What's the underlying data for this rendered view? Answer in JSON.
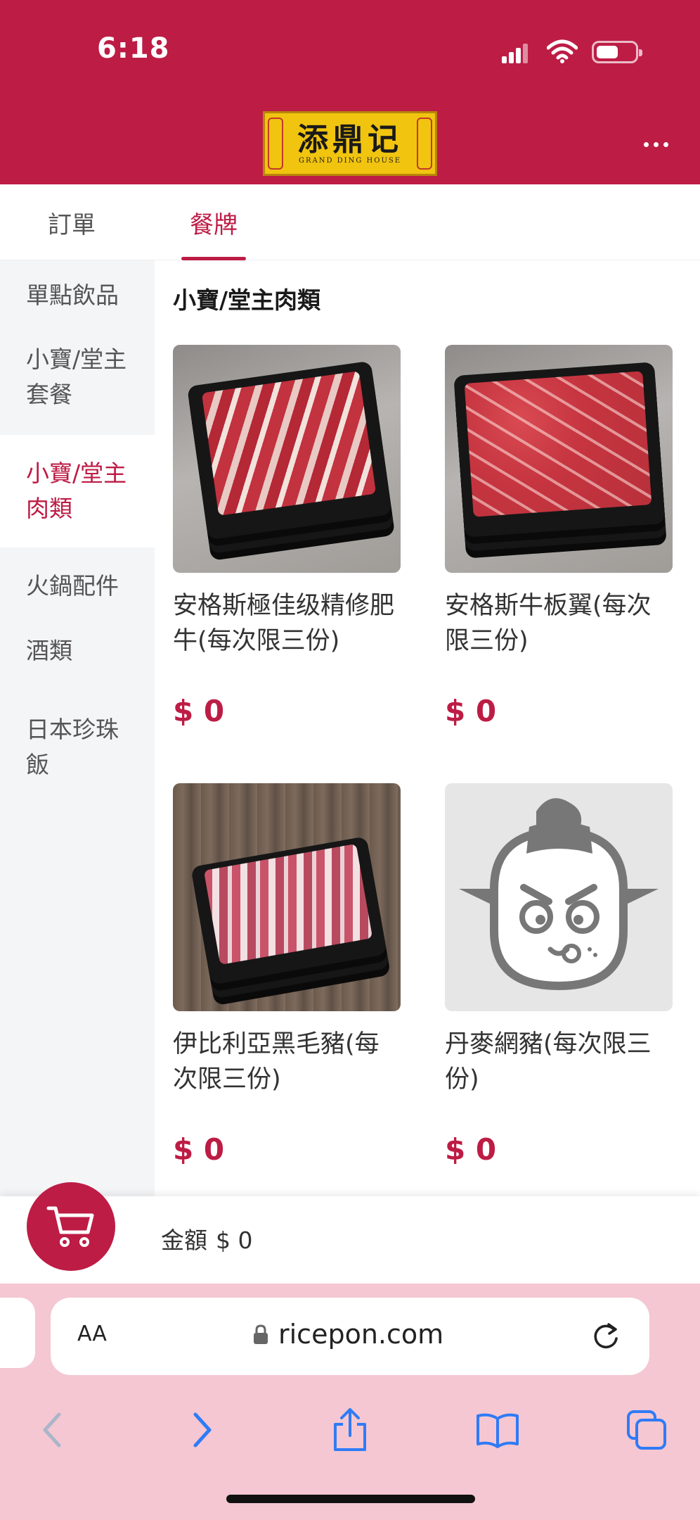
{
  "status_bar": {
    "time": "6:18"
  },
  "header": {
    "logo": {
      "text": "添鼎记",
      "subtitle": "GRAND DING HOUSE"
    },
    "more_icon": "more-horizontal-icon",
    "brand_color": "#bd1c45"
  },
  "tabs": [
    {
      "label": "訂單",
      "active": false
    },
    {
      "label": "餐牌",
      "active": true
    }
  ],
  "sidebar": {
    "items": [
      {
        "label": "單點飲品",
        "active": false
      },
      {
        "label": "小寶/堂主套餐",
        "active": false
      },
      {
        "label": "小寶/堂主肉類",
        "active": true
      },
      {
        "label": "火鍋配件",
        "active": false
      },
      {
        "label": "酒類",
        "active": false
      },
      {
        "label": "日本珍珠飯",
        "active": false
      }
    ]
  },
  "content": {
    "category_title": "小寶/堂主肉類",
    "products": [
      {
        "name": "安格斯極佳级精修肥牛(每次限三份)",
        "price": "$ 0",
        "image": "beef-photo"
      },
      {
        "name": "安格斯牛板翼(每次限三份)",
        "price": "$ 0",
        "image": "beef-photo"
      },
      {
        "name": "伊比利亞黑毛豬(每次限三份)",
        "price": "$ 0",
        "image": "pork-photo"
      },
      {
        "name": "丹麥網豬(每次限三份)",
        "price": "$ 0",
        "image": "placeholder-mascot"
      }
    ]
  },
  "cart": {
    "total_label": "金額",
    "total_value": "$ 0",
    "icon": "cart-icon"
  },
  "browser": {
    "text_size_label": "AA",
    "url": "ricepon.com",
    "nav_icons": [
      "back-icon",
      "forward-icon",
      "share-icon",
      "bookmarks-icon",
      "tabs-icon"
    ]
  }
}
